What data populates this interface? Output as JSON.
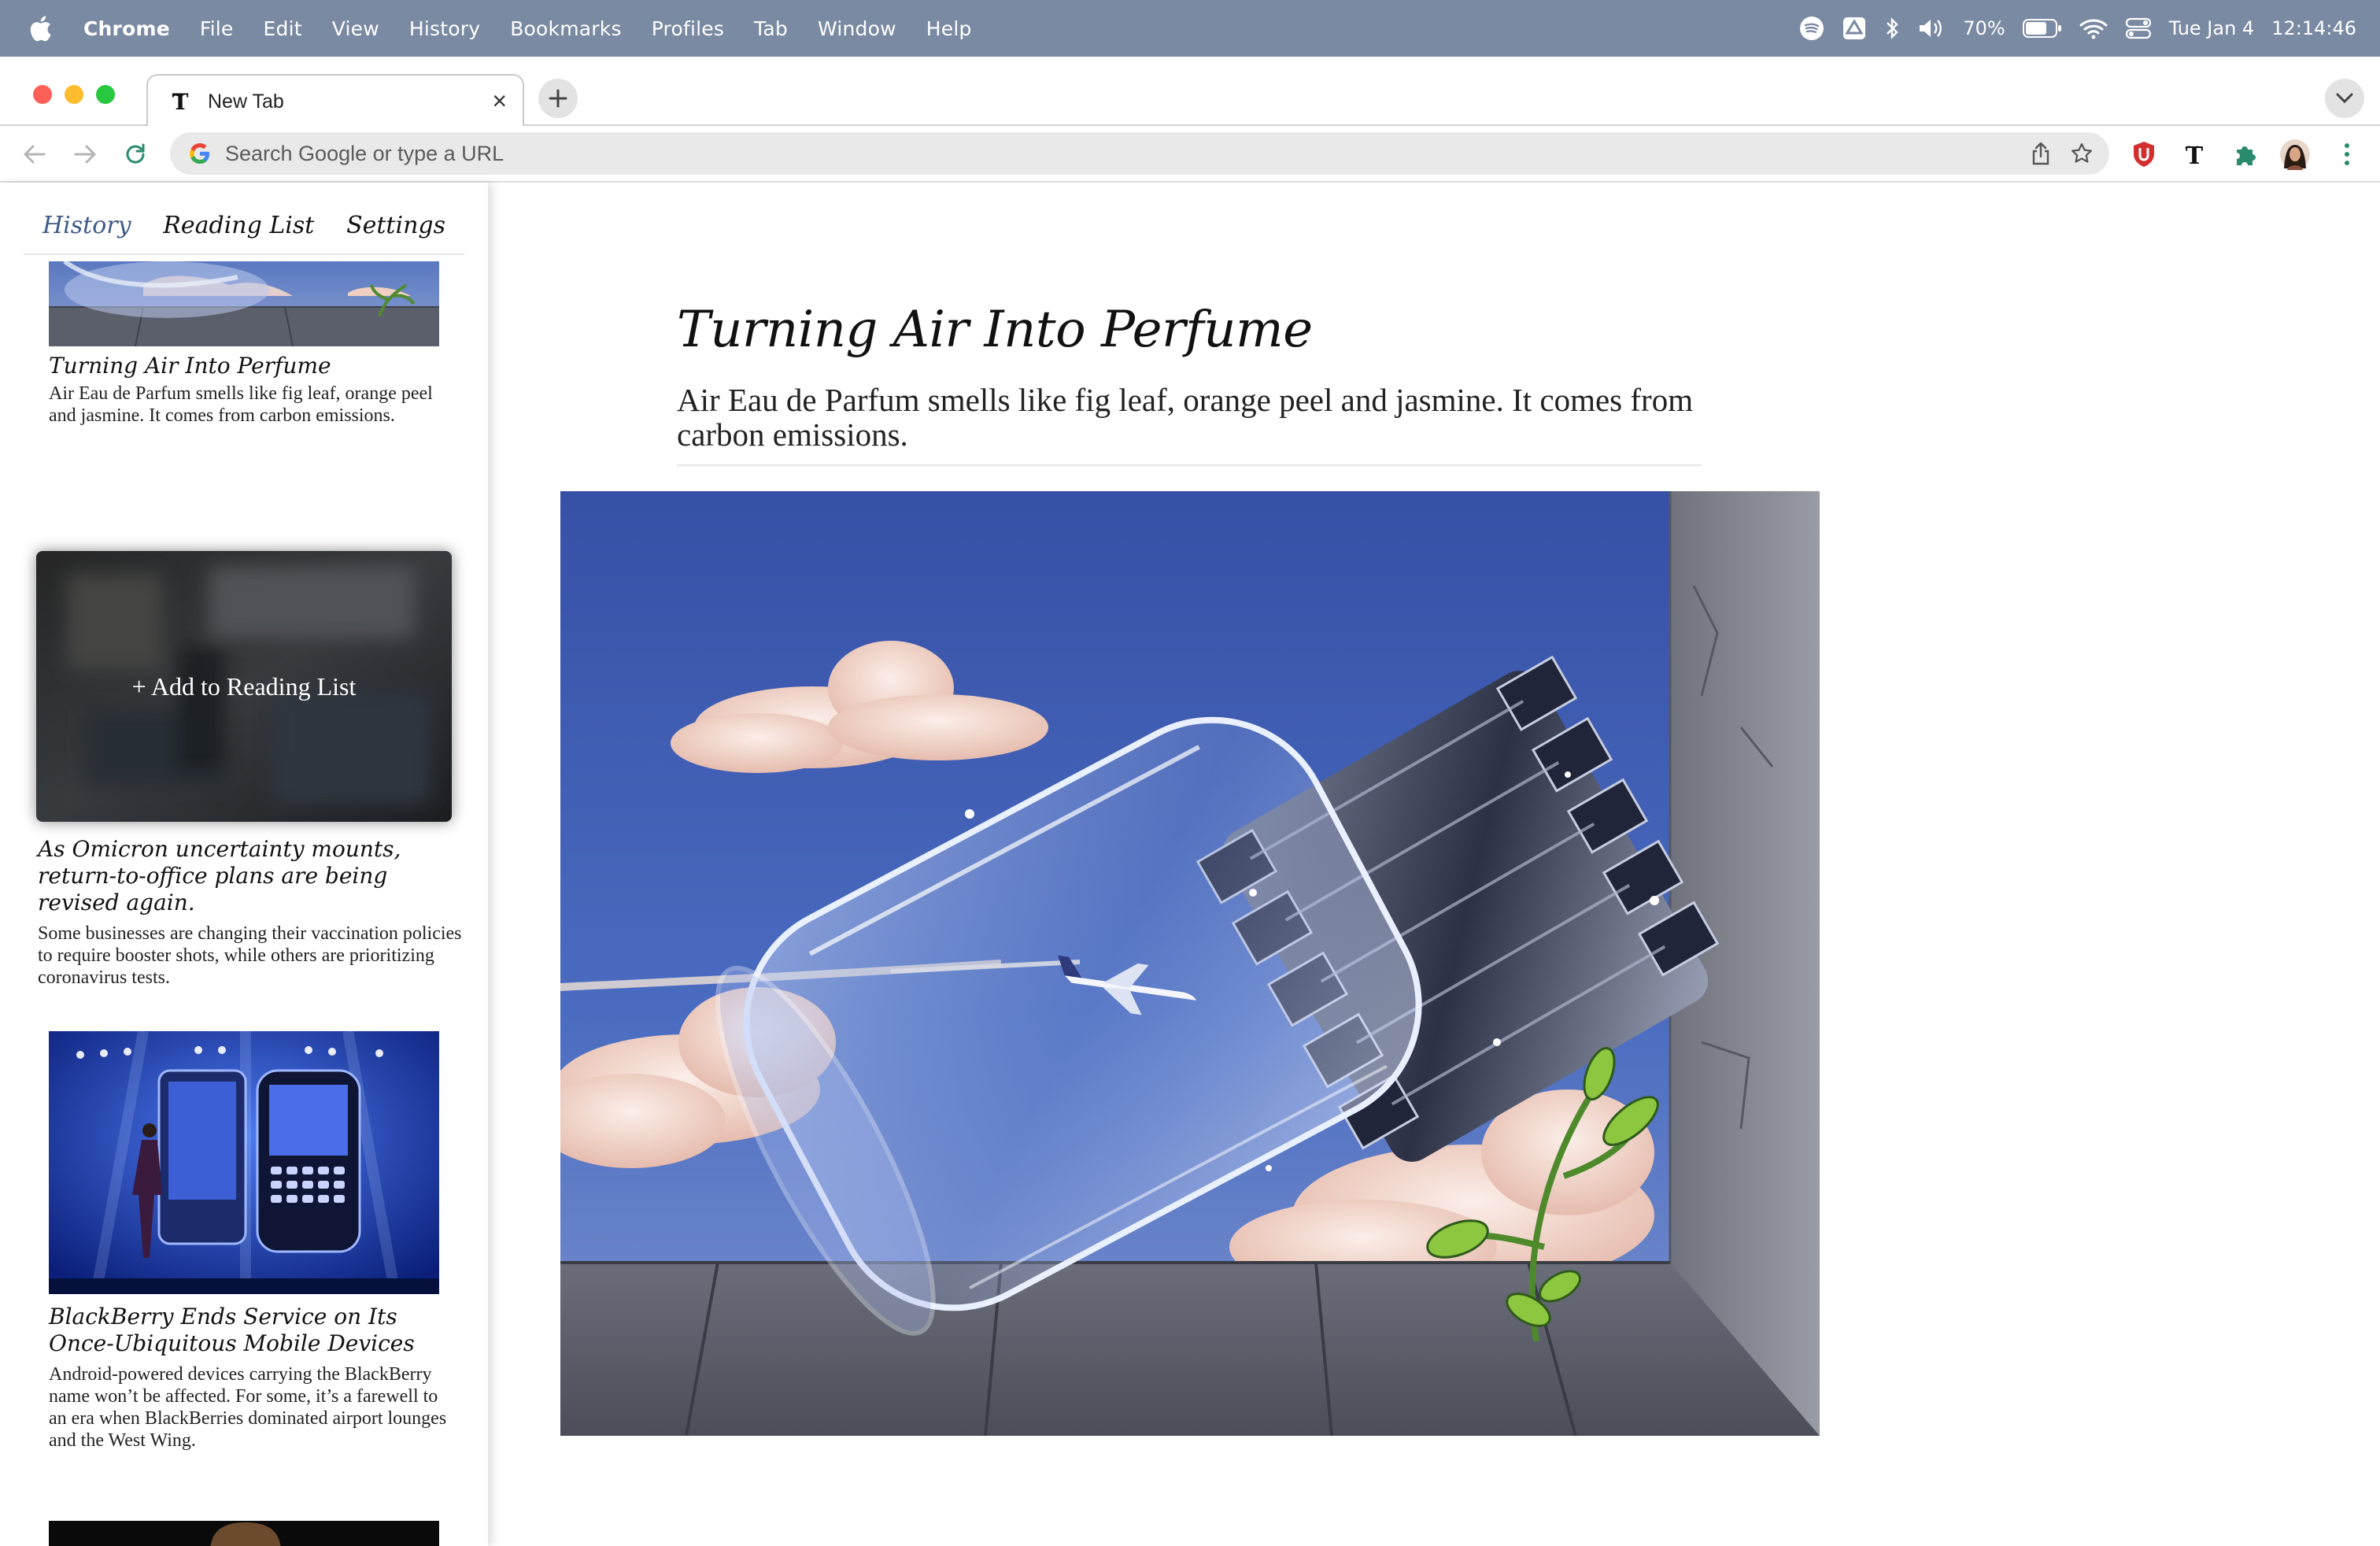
{
  "menubar": {
    "app": "Chrome",
    "items": [
      "File",
      "Edit",
      "View",
      "History",
      "Bookmarks",
      "Profiles",
      "Tab",
      "Window",
      "Help"
    ],
    "battery": "70%",
    "date": "Tue Jan 4",
    "time": "12:14:46"
  },
  "browser": {
    "tab_title": "New Tab",
    "omnibox_placeholder": "Search Google or type a URL"
  },
  "sidebar": {
    "tabs": [
      "History",
      "Reading List",
      "Settings"
    ],
    "active_tab": "History",
    "add_to_reading_list": "+ Add to Reading List",
    "cards": [
      {
        "title": "Turning Air Into Perfume",
        "desc": "Air Eau de Parfum smells like fig leaf, orange peel and jasmine. It comes from carbon emissions."
      },
      {
        "title": "As Omicron uncertainty mounts, return-to-office plans are being revised again.",
        "desc": "Some businesses are changing their vaccination policies to require booster shots, while others are prioritizing coronavirus tests."
      },
      {
        "title": "BlackBerry Ends Service on Its Once-Ubiquitous Mobile Devices",
        "desc": "Android-powered devices carrying the BlackBerry name won’t be affected. For some, it’s a farewell to an era when BlackBerries dominated airport lounges and the West Wing."
      }
    ]
  },
  "article": {
    "title": "Turning Air Into Perfume",
    "subtitle": "Air Eau de Parfum smells like fig leaf, orange peel and jasmine. It comes from carbon emissions."
  },
  "colors": {
    "menubar_bg": "#7a8aa2",
    "active_tab_text": "#3d5a86",
    "sky": "#3e5fae"
  }
}
